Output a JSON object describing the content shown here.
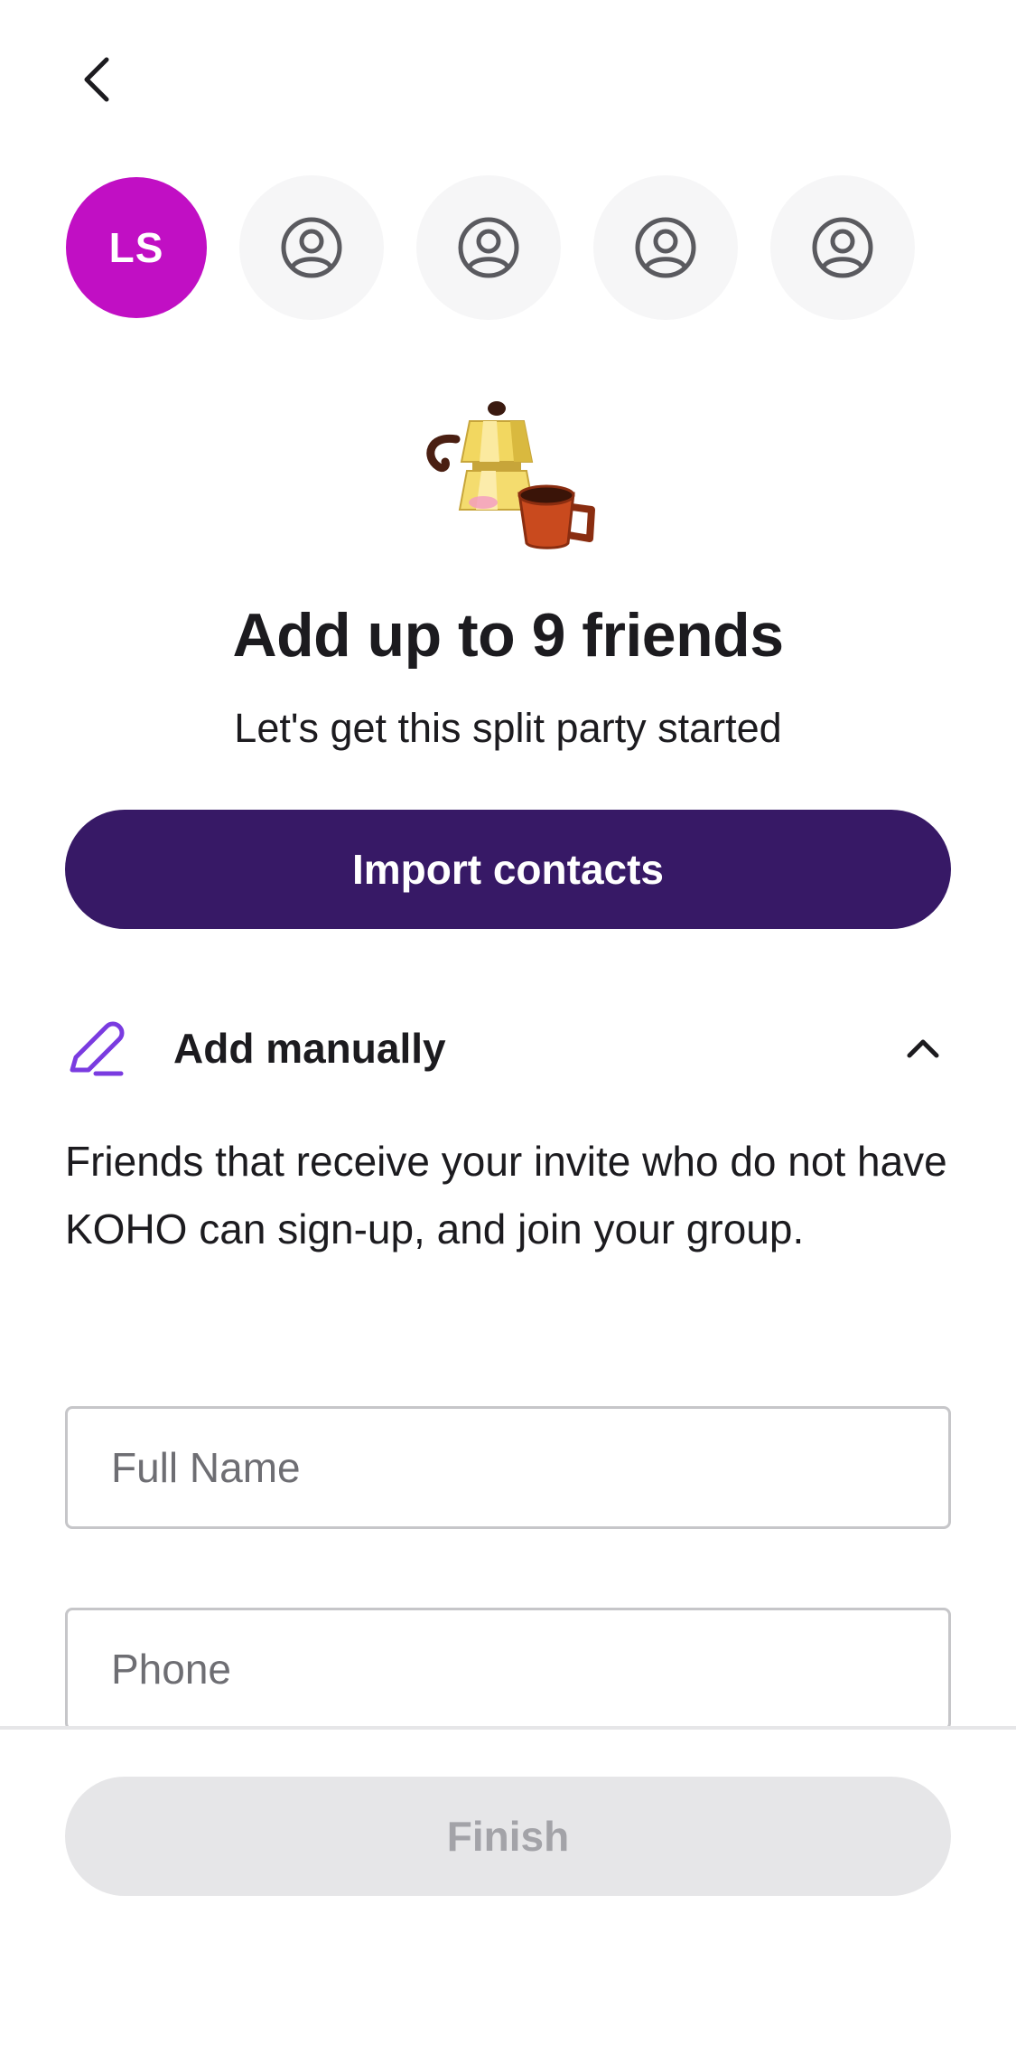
{
  "header": {
    "back_icon": "chevron-left-icon"
  },
  "avatars": {
    "current_user_initials": "LS",
    "current_user_color": "#c10fc4",
    "empty_slot_icon": "person-circle-icon",
    "empty_slots": 4
  },
  "hero": {
    "illustration": "moka-pot-and-cup-illustration",
    "title": "Add up to 9 friends",
    "subtitle": "Let's get this split party started"
  },
  "import_button": {
    "label": "Import contacts",
    "color": "#371966"
  },
  "manual_section": {
    "icon": "pencil-icon",
    "label": "Add manually",
    "toggle_icon": "chevron-up-icon",
    "description": "Friends that receive your invite who do not have KOHO can sign-up, and join your group."
  },
  "form": {
    "full_name": {
      "value": "",
      "placeholder": "Full Name"
    },
    "phone": {
      "value": "",
      "placeholder": "Phone"
    }
  },
  "footer": {
    "finish_label": "Finish"
  }
}
